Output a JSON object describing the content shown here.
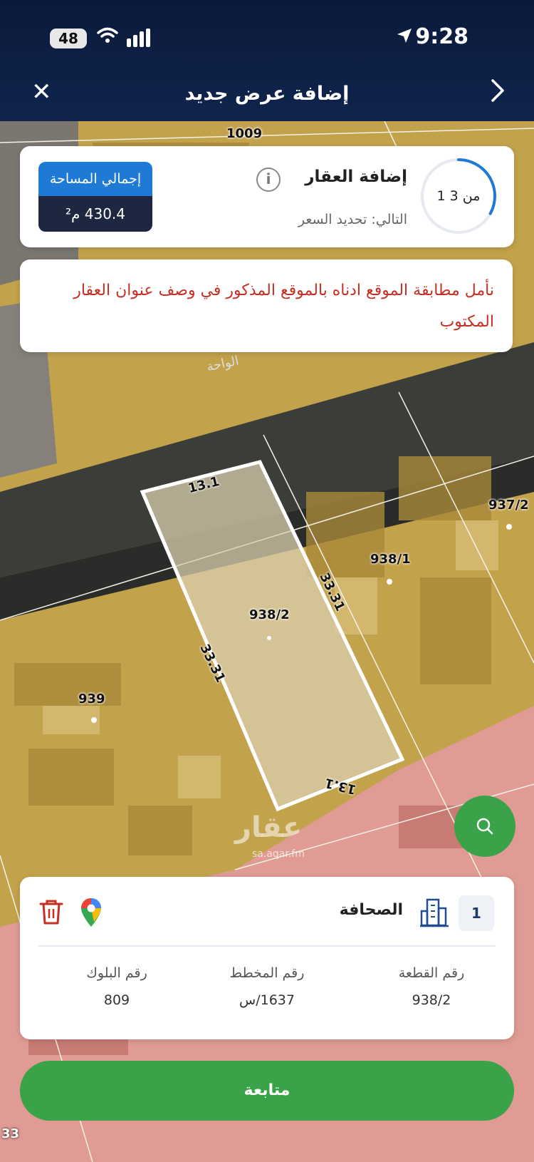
{
  "status_bar": {
    "time": "9:28",
    "battery": "48"
  },
  "nav": {
    "title": "إضافة عرض جديد"
  },
  "step": {
    "progress_label": "1 من 3",
    "progress": 0.33,
    "title": "إضافة العقار",
    "next_label": "التالي: تحديد السعر"
  },
  "area": {
    "label": "إجمالي المساحة",
    "value": "430.4 م²"
  },
  "notice": {
    "text": "نأمل مطابقة الموقع ادناه بالموقع المذكور في وصف عنوان العقار المكتوب"
  },
  "map": {
    "parcel_labels": [
      "1009",
      "937/2",
      "938/1",
      "938/2",
      "939"
    ],
    "dimension_labels": [
      "13.1",
      "33.31",
      "33.31",
      "13.1"
    ],
    "street_name": "الواحة",
    "watermark": "عقار",
    "watermark_url": "sa.aqar.fm",
    "edge_label": "33"
  },
  "parcel": {
    "index": "1",
    "district": "الصحافة",
    "fields": [
      {
        "label": "رقم القطعة",
        "value": "938/2"
      },
      {
        "label": "رقم المخطط",
        "value": "1637/س"
      },
      {
        "label": "رقم البلوك",
        "value": "809"
      }
    ]
  },
  "actions": {
    "continue_label": "متابعة"
  },
  "colors": {
    "accent_green": "#3aa34a",
    "brand_blue": "#1f7ad6",
    "notice_red": "#c62f23",
    "nav_dark": "#0b1a3a"
  }
}
